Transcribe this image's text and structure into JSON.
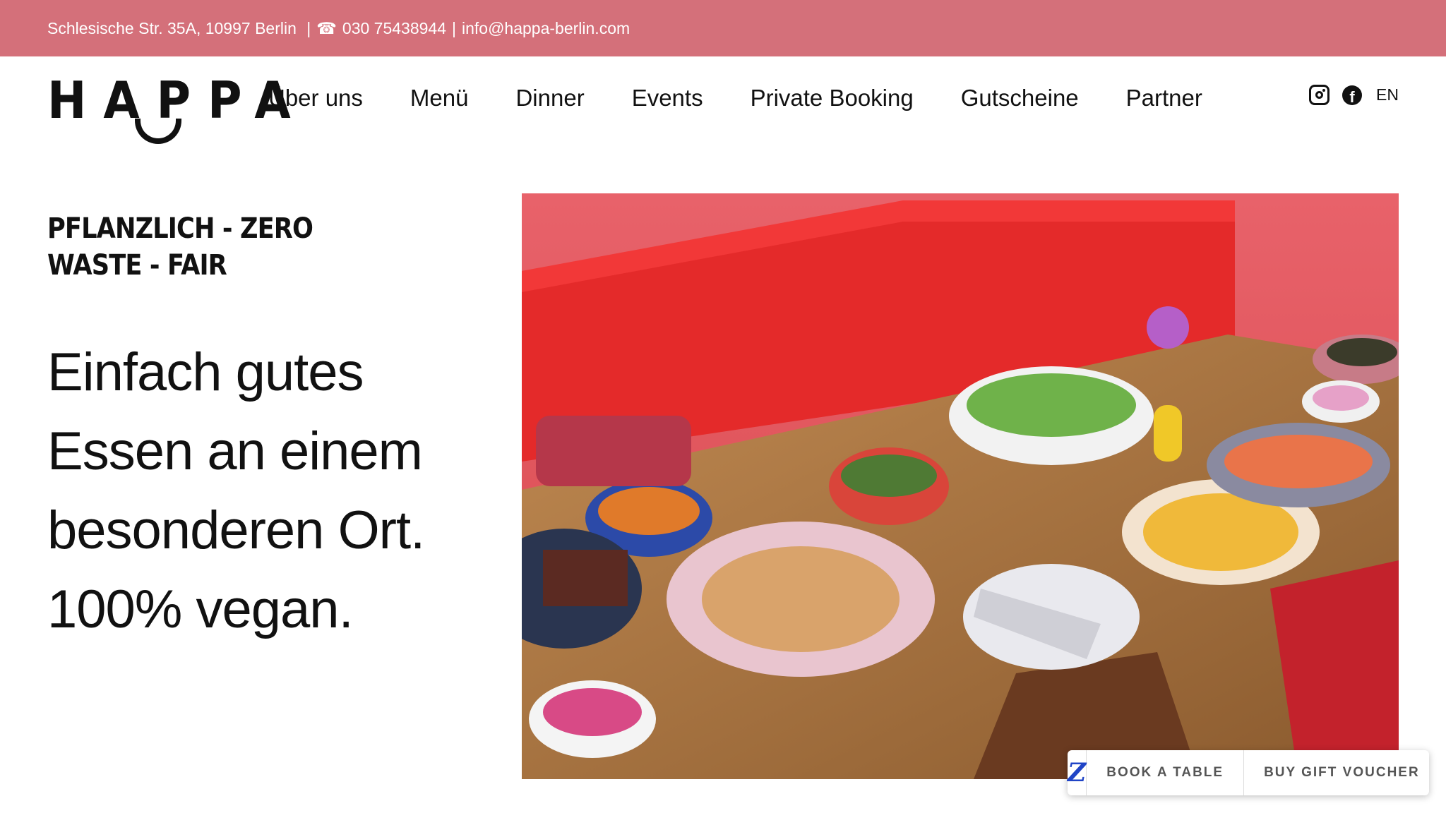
{
  "topbar": {
    "address": "Schlesische Str. 35A, 10997 Berlin",
    "phone_icon": "☎",
    "phone": "030 75438944",
    "email": "info@happa-berlin.com",
    "background_color": "#d4707a"
  },
  "brand": {
    "logo_text": "HAPPA"
  },
  "nav": {
    "items": [
      {
        "label": "Über uns"
      },
      {
        "label": "Menü"
      },
      {
        "label": "Dinner"
      },
      {
        "label": "Events"
      },
      {
        "label": "Private Booking"
      },
      {
        "label": "Gutscheine"
      },
      {
        "label": "Partner"
      }
    ]
  },
  "social": {
    "instagram_icon": "instagram-icon",
    "facebook_icon": "facebook-icon",
    "facebook_glyph": "f",
    "language": "EN"
  },
  "hero": {
    "tagline": "PFLANZLICH - ZERO WASTE - FAIR",
    "headline": "Einfach gutes Essen an einem besonderen Ort. 100% vegan."
  },
  "booking_widget": {
    "logo_glyph": "Z",
    "book_label": "BOOK A TABLE",
    "voucher_label": "BUY GIFT VOUCHER"
  }
}
